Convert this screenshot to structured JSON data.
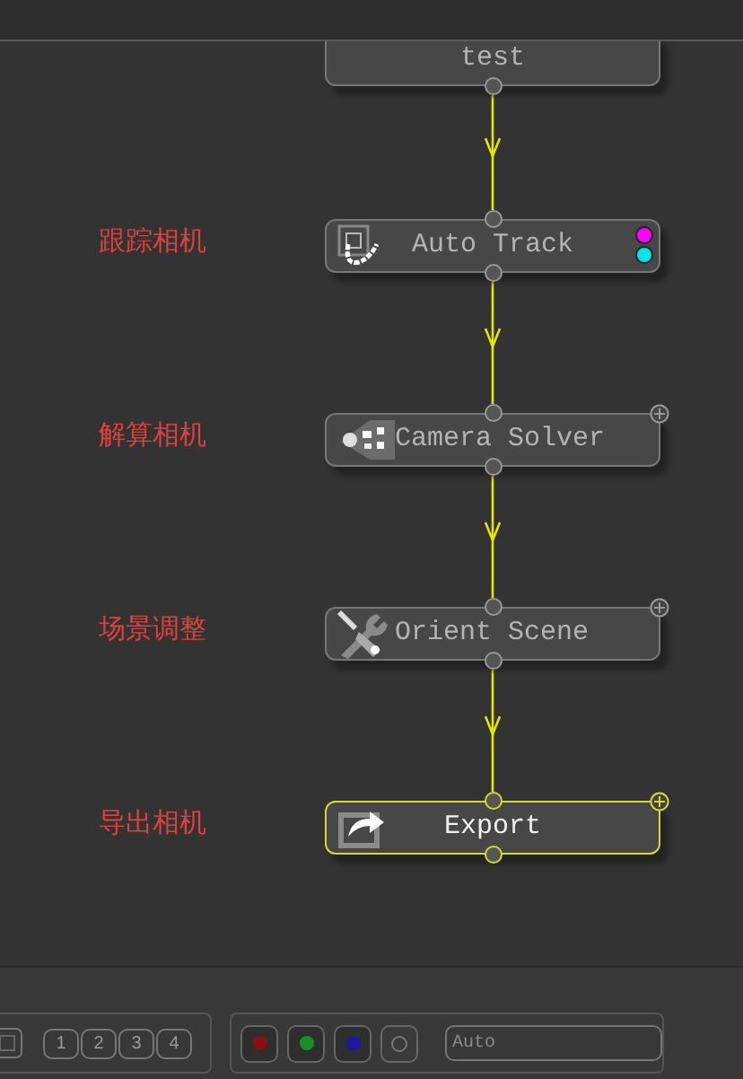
{
  "nodes": [
    {
      "label": "test",
      "kind": "plain",
      "selected": false,
      "plus": false
    },
    {
      "label": "Auto Track",
      "annotation": "跟踪相机",
      "kind": "track",
      "selected": false,
      "plus": false,
      "indicators": [
        {
          "color": "#ff00ff"
        },
        {
          "color": "#00e5e5"
        }
      ]
    },
    {
      "label": "Camera Solver",
      "annotation": "解算相机",
      "kind": "solver",
      "selected": false,
      "plus": true
    },
    {
      "label": "Orient Scene",
      "annotation": "场景调整",
      "kind": "orient",
      "selected": false,
      "plus": true
    },
    {
      "label": "Export",
      "annotation": "导出相机",
      "kind": "export",
      "selected": true,
      "plus": true
    }
  ],
  "bottom_bar": {
    "view_buttons": [
      {
        "label": "1"
      },
      {
        "label": "2"
      },
      {
        "label": "3"
      },
      {
        "label": "4"
      }
    ],
    "channel_buttons": [
      {
        "kind": "dot",
        "color": "#8a1010"
      },
      {
        "kind": "dot",
        "color": "#15902a"
      },
      {
        "kind": "dot",
        "color": "#1a1aa0"
      },
      {
        "kind": "ring"
      }
    ],
    "mode_dropdown": {
      "value": "Auto"
    }
  }
}
